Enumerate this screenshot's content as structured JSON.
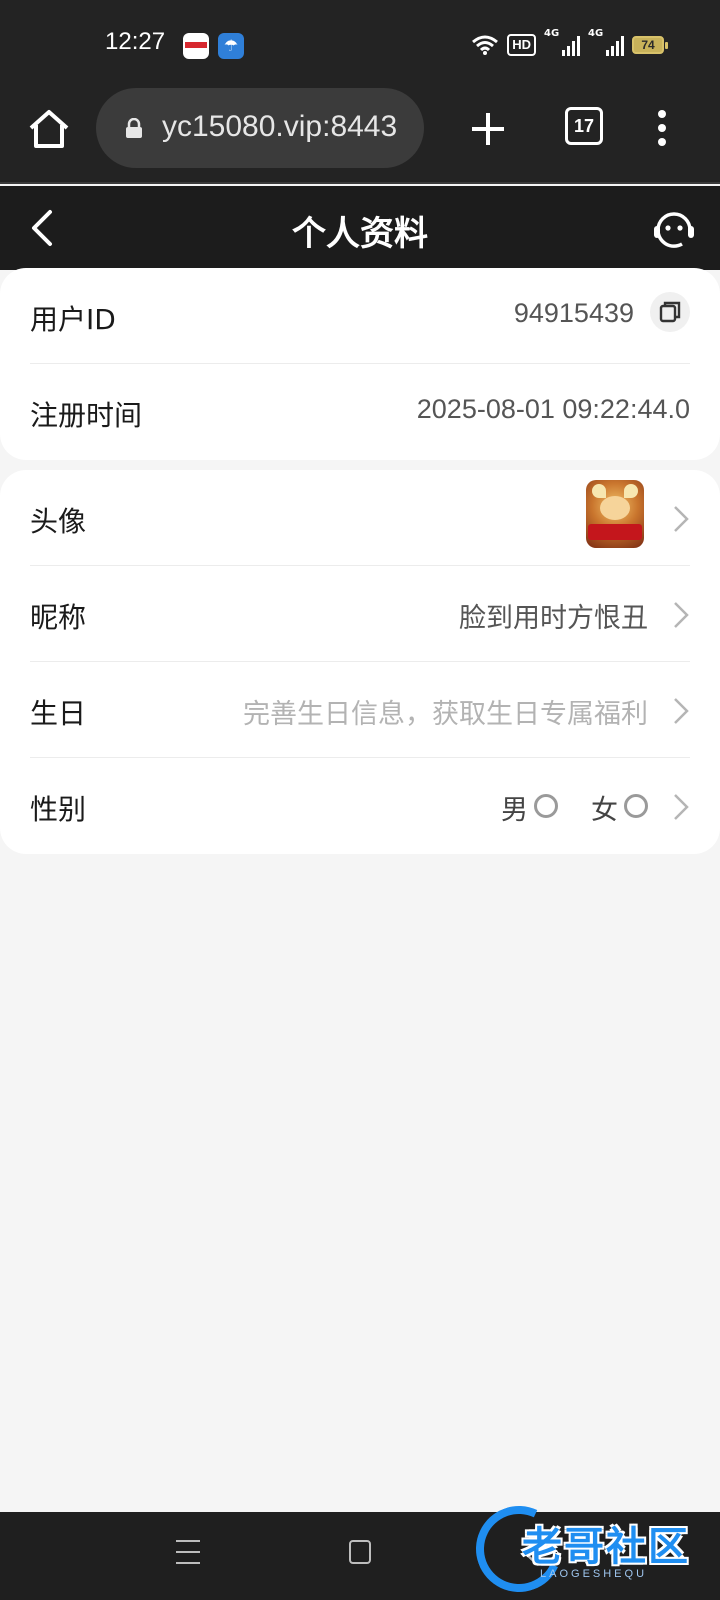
{
  "status_bar": {
    "time": "12:27",
    "hd_label": "HD",
    "network_1": "4G",
    "network_2": "4G",
    "battery": "74"
  },
  "browser": {
    "url": "yc15080.vip:8443",
    "tab_count": "17"
  },
  "header": {
    "title": "个人资料"
  },
  "profile": {
    "user_id_label": "用户ID",
    "user_id": "94915439",
    "register_time_label": "注册时间",
    "register_time": "2025-08-01 09:22:44.0",
    "avatar_label": "头像",
    "nickname_label": "昵称",
    "nickname": "脸到用时方恨丑",
    "birthday_label": "生日",
    "birthday_placeholder": "完善生日信息，获取生日专属福利",
    "gender_label": "性别",
    "gender_options": [
      "男",
      "女"
    ]
  },
  "watermark": {
    "title": "老哥社区",
    "subtitle": "LAOGESHEQU"
  },
  "colors": {
    "header_bg": "#1c1c1c",
    "page_bg": "#f5f5f5",
    "card_bg": "#ffffff",
    "watermark_blue": "#1f8ef1"
  }
}
